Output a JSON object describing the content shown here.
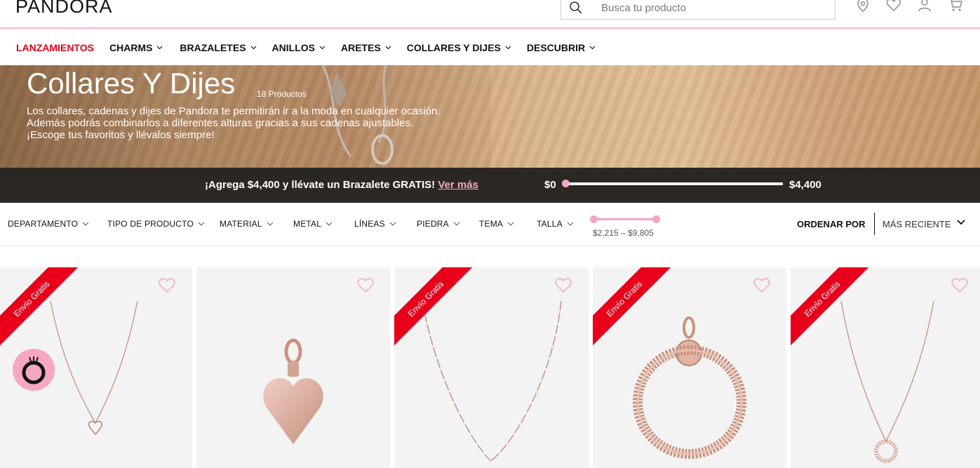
{
  "header": {
    "logo": "PANDORA",
    "search_placeholder": "Busca tu producto",
    "icons": [
      "location-pin-icon",
      "heart-icon",
      "user-icon",
      "cart-icon"
    ]
  },
  "nav": {
    "items": [
      {
        "label": "LANZAMIENTOS",
        "active": true,
        "has_dropdown": false
      },
      {
        "label": "CHARMS",
        "has_dropdown": true
      },
      {
        "label": "BRAZALETES",
        "has_dropdown": true
      },
      {
        "label": "ANILLOS",
        "has_dropdown": true
      },
      {
        "label": "ARETES",
        "has_dropdown": true
      },
      {
        "label": "COLLARES Y DIJES",
        "has_dropdown": true
      },
      {
        "label": "DESCUBRIR",
        "has_dropdown": true
      }
    ]
  },
  "hero": {
    "title": "Collares Y Dijes",
    "count": "18 Productos",
    "description": "Los collares, cadenas y dijes de Pandora te permitirán ir a la moda en cualquier ocasión. Además podrás combinarlos a diferentes alturas gracias a sus cadenas ajustables. ¡Escoge tus favoritos y llévalos siempre!"
  },
  "promo": {
    "message": "¡Agrega $4,400 y llévate un Brazalete GRATIS!",
    "link": "Ver más",
    "min": "$0",
    "max": "$4,400",
    "progress": 0
  },
  "filters": {
    "items": [
      "DEPARTAMENTO",
      "TIPO DE PRODUCTO",
      "MATERIAL",
      "METAL",
      "LÍNEAS",
      "PIEDRA",
      "TEMA",
      "TALLA"
    ],
    "price_range": "$2,215 – $9,805",
    "sort_label": "ORDENAR POR",
    "sort_value": "MÁS RECIENTE"
  },
  "products": [
    {
      "ribbon": "Envío Gratis",
      "kind": "heart-pendant-necklace"
    },
    {
      "ribbon": "",
      "kind": "heart-dangle-charm"
    },
    {
      "ribbon": "Envío Gratis",
      "kind": "beaded-chain-necklace"
    },
    {
      "ribbon": "Envío Gratis",
      "kind": "o-pendant"
    },
    {
      "ribbon": "Envío Gratis",
      "kind": "circle-pendant-necklace"
    }
  ],
  "colors": {
    "accent_red": "#e0001b",
    "pink": "#f3a6bf",
    "promo_bg": "#2b2824",
    "rose_gold": "#c98f7d"
  }
}
